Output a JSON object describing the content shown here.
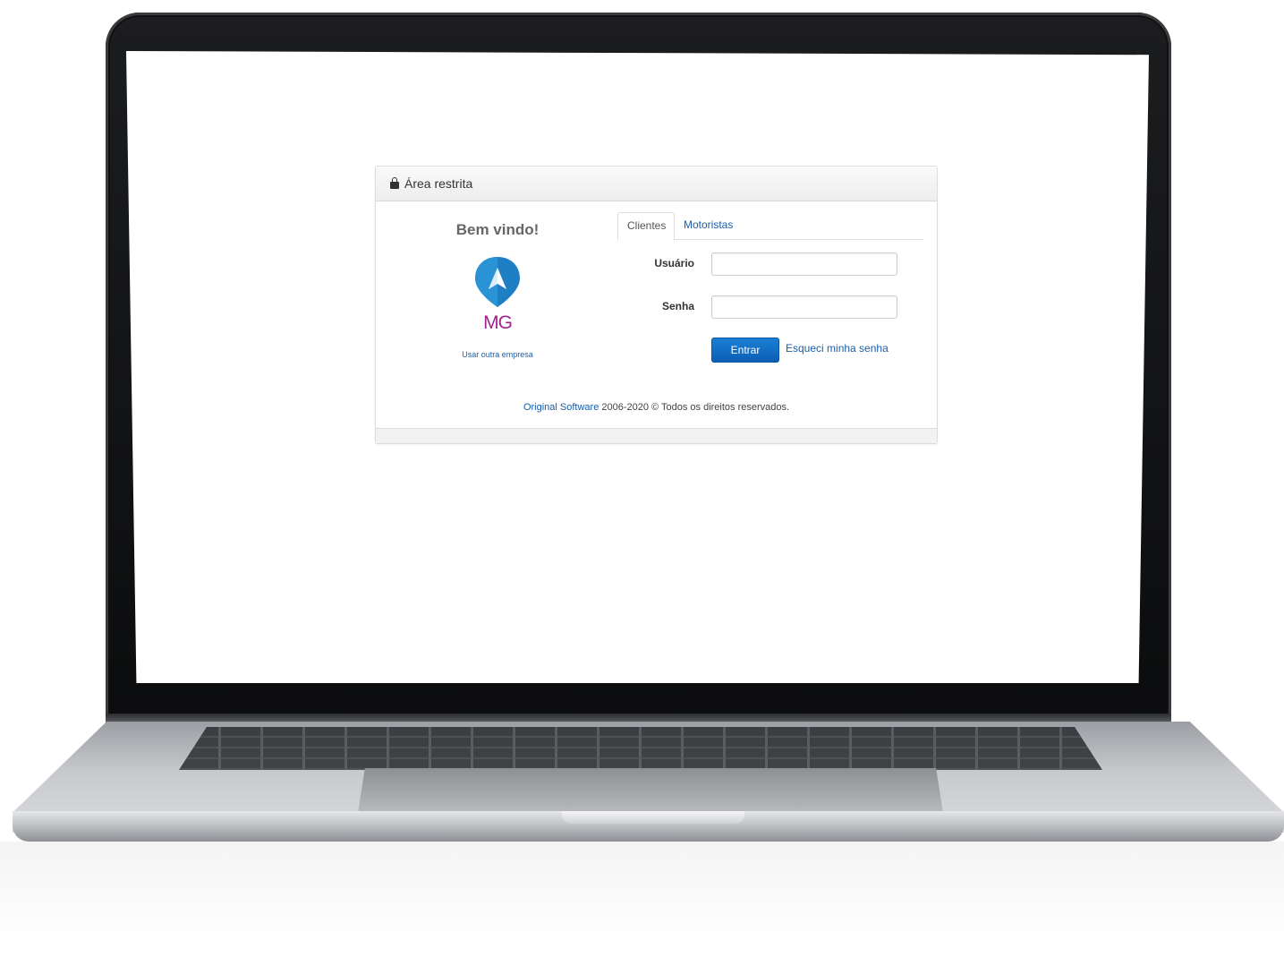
{
  "panel": {
    "title": "Área restrita"
  },
  "brand": {
    "welcome": "Bem vindo!",
    "logo_text": "MG",
    "other_company_link": "Usar outra empresa",
    "colors": {
      "logo_blue": "#1f7fc4",
      "logo_magenta": "#a0248c",
      "link": "#1a5ea8",
      "primary_button": "#0a66c2"
    }
  },
  "tabs": [
    {
      "label": "Clientes",
      "active": true
    },
    {
      "label": "Motoristas",
      "active": false
    }
  ],
  "form": {
    "username_label": "Usuário",
    "username_value": "",
    "password_label": "Senha",
    "password_value": "",
    "submit_label": "Entrar",
    "forgot_label": "Esqueci minha senha"
  },
  "footer": {
    "company_link": "Original Software",
    "text": " 2006-2020 © Todos os direitos reservados."
  },
  "icons": {
    "panel_icon": "lock-icon",
    "logo_icon": "location-pin-arrow-icon"
  }
}
